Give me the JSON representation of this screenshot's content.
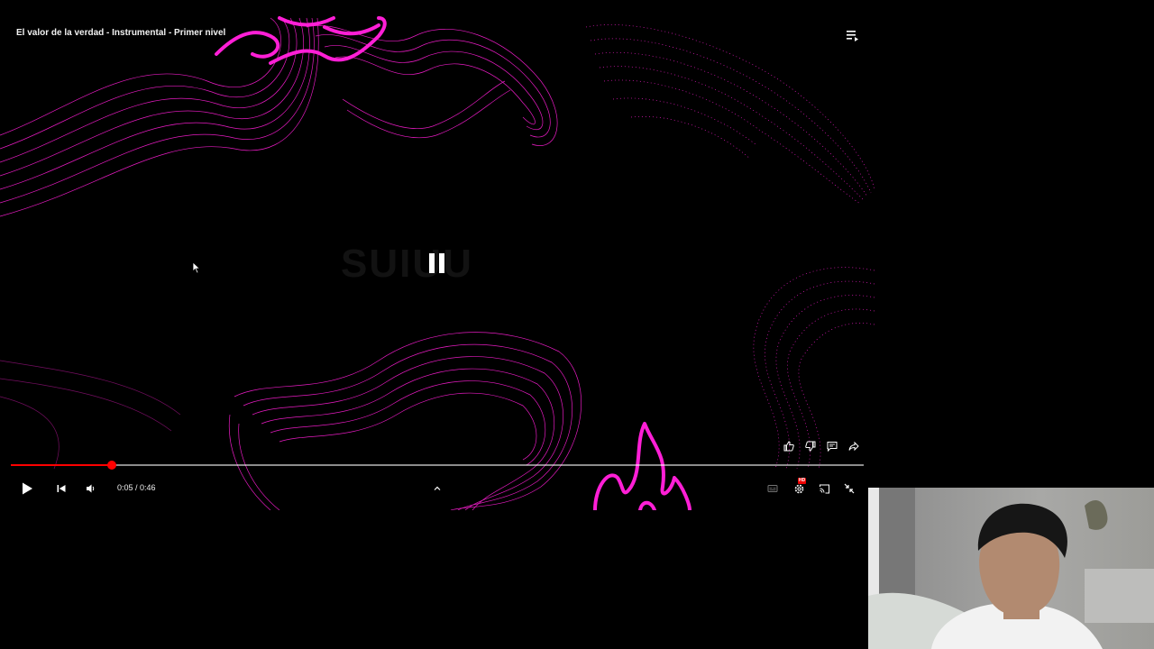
{
  "player": {
    "title": "El valor de la verdad - Instrumental - Primer nivel",
    "watermark": "SUIUU",
    "state": "paused",
    "current_time": "0:05",
    "duration": "0:46",
    "time_separator": " / ",
    "progress_fraction": 0.118,
    "hd_badge": "HD",
    "colors": {
      "accent": "#ff0000",
      "visual": "#ff1fd6",
      "background": "#000000"
    },
    "icons": {
      "playlist": "playlist-icon",
      "center": "pause-icon",
      "like": "thumbs-up-icon",
      "dislike": "thumbs-down-icon",
      "comment": "comment-icon",
      "share": "share-icon",
      "play": "play-icon",
      "previous": "skip-previous-icon",
      "volume": "volume-icon",
      "expand": "chevron-up-icon",
      "subtitles": "subtitles-icon",
      "settings": "gear-icon",
      "cast": "cast-icon",
      "exit_fullscreen": "exit-fullscreen-icon"
    }
  }
}
